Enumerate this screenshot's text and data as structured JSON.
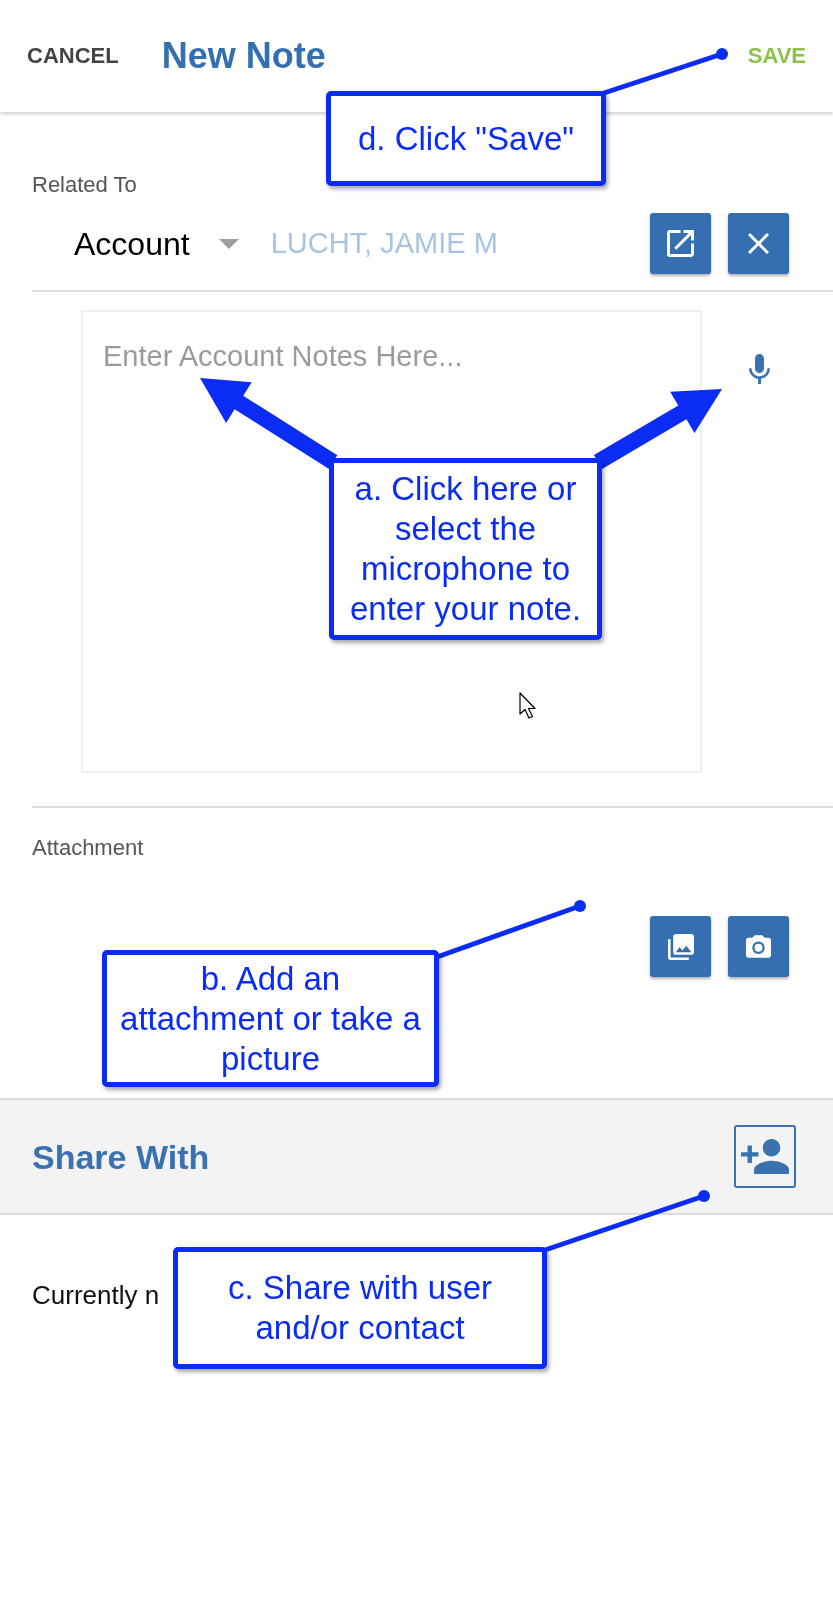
{
  "header": {
    "cancel": "CANCEL",
    "title": "New Note",
    "save": "SAVE"
  },
  "related_to": {
    "label": "Related To",
    "record_type": "Account",
    "record_name": "LUCHT, JAMIE M"
  },
  "note": {
    "placeholder": "Enter Account Notes Here..."
  },
  "attachment": {
    "label": "Attachment"
  },
  "share_with": {
    "title": "Share With",
    "status": "Currently n"
  },
  "annotations": [
    {
      "kind": "leader",
      "text": "d. Click \"Save\""
    },
    {
      "kind": "arrows",
      "text": "a. Click here or select the microphone to enter your note."
    },
    {
      "kind": "leader",
      "text": "b. Add an attachment or take a picture"
    },
    {
      "kind": "leader",
      "text": "c. Share with user and/or contact"
    }
  ]
}
